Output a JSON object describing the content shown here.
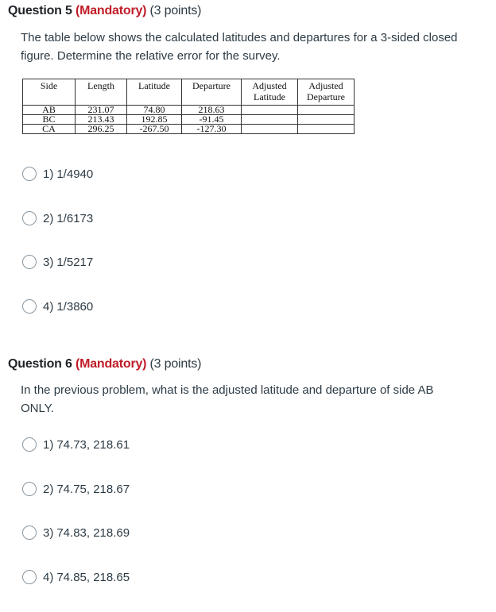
{
  "questions": [
    {
      "number_label": "Question 5",
      "mandatory_label": "(Mandatory)",
      "points_label": "(3 points)",
      "prompt": "The table below shows the calculated latitudes and departures for a 3-sided closed figure. Determine the relative error for the survey.",
      "table": {
        "headers": [
          "Side",
          "Length",
          "Latitude",
          "Departure",
          "Adjusted Latitude",
          "Adjusted Departure"
        ],
        "header_lines": [
          [
            "Side"
          ],
          [
            "Length"
          ],
          [
            "Latitude"
          ],
          [
            "Departure"
          ],
          [
            "Adjusted",
            "Latitude"
          ],
          [
            "Adjusted",
            "Departure"
          ]
        ],
        "rows": [
          [
            "AB",
            "231.07",
            "74.80",
            "218.63",
            "",
            ""
          ],
          [
            "BC",
            "213.43",
            "192.85",
            "-91.45",
            "",
            ""
          ],
          [
            "CA",
            "296.25",
            "-267.50",
            "-127.30",
            "",
            ""
          ]
        ]
      },
      "options": [
        {
          "num": "1)",
          "text": "1/4940",
          "selected": false
        },
        {
          "num": "2)",
          "text": "1/6173",
          "selected": false
        },
        {
          "num": "3)",
          "text": "1/5217",
          "selected": false
        },
        {
          "num": "4)",
          "text": "1/3860",
          "selected": false
        }
      ]
    },
    {
      "number_label": "Question 6",
      "mandatory_label": "(Mandatory)",
      "points_label": "(3 points)",
      "prompt": "In the previous problem, what is the adjusted latitude and departure of side AB ONLY.",
      "options": [
        {
          "num": "1)",
          "text": "74.73, 218.61",
          "selected": false
        },
        {
          "num": "2)",
          "text": "74.75, 218.67",
          "selected": false
        },
        {
          "num": "3)",
          "text": "74.83, 218.69",
          "selected": false
        },
        {
          "num": "4)",
          "text": "74.85, 218.65",
          "selected": false
        }
      ]
    }
  ],
  "colors": {
    "mandatory": "#c01c28",
    "text": "#2d3b45",
    "radio_border": "#8b969e"
  }
}
